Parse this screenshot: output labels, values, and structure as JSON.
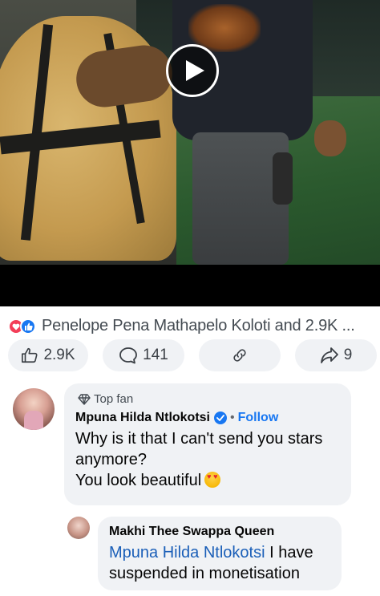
{
  "video": {
    "play_icon": "play-icon"
  },
  "reactions": {
    "icons": [
      "love-reaction-icon",
      "like-reaction-icon"
    ],
    "summary": "Penelope Pena Mathapelo Koloti and 2.9K ..."
  },
  "actions": {
    "like_count": "2.9K",
    "comment_count": "141",
    "share_count": "9"
  },
  "comments": [
    {
      "badge": "Top fan",
      "author": "Mpuna Hilda Ntlokotsi",
      "separator": "•",
      "follow_label": "Follow",
      "text_line1": "Why is it that I can't send you stars anymore?",
      "text_line2": "You look beautiful"
    }
  ],
  "reply": {
    "author": "Makhi Thee Swappa Queen",
    "mention": "Mpuna Hilda Ntlokotsi",
    "text": " I have suspended in monetisation"
  },
  "colors": {
    "accent": "#1877f2",
    "mention": "#1b5fb8",
    "bubble": "#f0f2f5",
    "love": "#f33e58"
  }
}
